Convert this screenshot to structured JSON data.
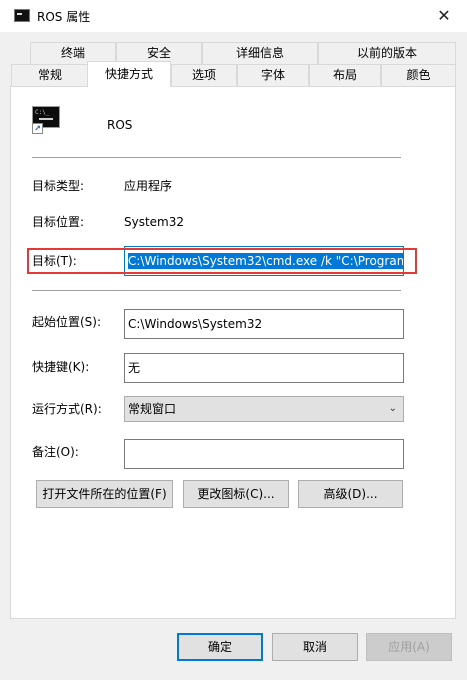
{
  "window": {
    "title": "ROS 属性",
    "close_glyph": "✕"
  },
  "tabs": {
    "row1": [
      "终端",
      "安全",
      "详细信息",
      "以前的版本"
    ],
    "row2": [
      "常规",
      "快捷方式",
      "选项",
      "字体",
      "布局",
      "颜色"
    ],
    "active": "快捷方式"
  },
  "shortcut": {
    "name": "ROS",
    "icon": "cmd-shortcut-icon",
    "type_label": "目标类型:",
    "type_value": "应用程序",
    "location_label": "目标位置:",
    "location_value": "System32",
    "target_label": "目标(T):",
    "target_value": "C:\\Windows\\System32\\cmd.exe /k \"C:\\Program",
    "start_in_label": "起始位置(S):",
    "start_in_value": "C:\\Windows\\System32",
    "hotkey_label": "快捷键(K):",
    "hotkey_value": "无",
    "run_label": "运行方式(R):",
    "run_value": "常规窗口",
    "comment_label": "备注(O):",
    "comment_value": ""
  },
  "actions": {
    "open_location": "打开文件所在的位置(F)",
    "change_icon": "更改图标(C)...",
    "advanced": "高级(D)..."
  },
  "footer": {
    "ok": "确定",
    "cancel": "取消",
    "apply": "应用(A)"
  },
  "colors": {
    "accent": "#0078d7",
    "highlight_box": "#e53935"
  }
}
